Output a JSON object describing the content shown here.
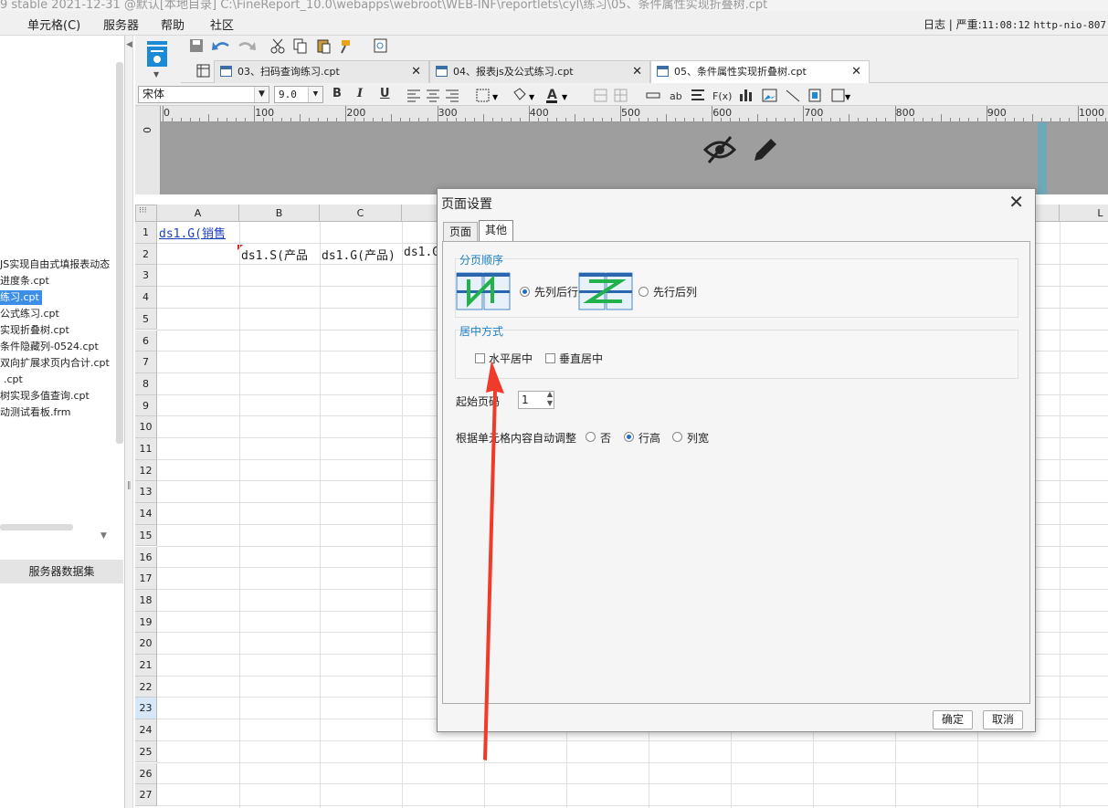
{
  "titlebar": {
    "text": "9 stable 2021-12-31 @默认[本地目录]   C:\\FineReport_10.0\\webapps\\webroot\\WEB-INF\\reportlets\\cyl\\练习\\05、条件属性实现折叠树.cpt"
  },
  "menubar": {
    "items": [
      "单元格(C)",
      "服务器",
      "帮助",
      "社区"
    ],
    "log_label": "日志",
    "level_label": "严重:",
    "time": "11:08:12",
    "url": "http-nio-807"
  },
  "tree": {
    "items": [
      "JS实现自由式填报表动态",
      "进度条.cpt",
      "练习.cpt",
      "公式练习.cpt",
      "实现折叠树.cpt",
      "条件隐藏列-0524.cpt",
      "双向扩展求页内合计.cpt",
      ".cpt",
      "树实现多值查询.cpt",
      "动测试看板.frm"
    ],
    "server_dataset": "服务器数据集"
  },
  "tabs": [
    {
      "label": "03、扫码查询练习.cpt"
    },
    {
      "label": "04、报表js及公式练习.cpt"
    },
    {
      "label": "05、条件属性实现折叠树.cpt"
    }
  ],
  "format": {
    "font": "宋体",
    "size": "9.0",
    "bold": "B",
    "italic": "I",
    "underline": "U",
    "text_color": "A",
    "ab": "ab",
    "fx": "F(x)"
  },
  "ruler": {
    "labels": [
      "0",
      "100",
      "200",
      "300",
      "400",
      "500",
      "600",
      "700",
      "800",
      "900",
      "1000"
    ],
    "vlabel": "0"
  },
  "grid": {
    "columns": [
      "A",
      "B",
      "C",
      "L"
    ],
    "rows": [
      "1",
      "2",
      "3",
      "4",
      "5",
      "6",
      "7",
      "8",
      "9",
      "10",
      "11",
      "12",
      "13",
      "14",
      "15",
      "16",
      "17",
      "18",
      "19",
      "20",
      "21",
      "22",
      "23",
      "24",
      "25",
      "26",
      "27"
    ],
    "cells": {
      "a1": "ds1.G(销售",
      "b2": "ds1.S(产品",
      "c2": "ds1.G(产品)",
      "d2": "ds1.G"
    }
  },
  "dialog": {
    "title": "页面设置",
    "tabs": [
      "页面",
      "其他"
    ],
    "page_order_title": "分页顺序",
    "col_first": "先列后行",
    "row_first": "先行后列",
    "center_title": "居中方式",
    "h_center": "水平居中",
    "v_center": "垂直居中",
    "start_page_label": "起始页码",
    "start_page_value": "1",
    "auto_adjust_label": "根据单元格内容自动调整",
    "opt_no": "否",
    "opt_row_height": "行高",
    "opt_col_width": "列宽",
    "ok": "确定",
    "cancel": "取消"
  },
  "colors": {
    "accent": "#1b7fc7",
    "arrow": "#f03a2a",
    "selection": "#3c8ee6"
  }
}
